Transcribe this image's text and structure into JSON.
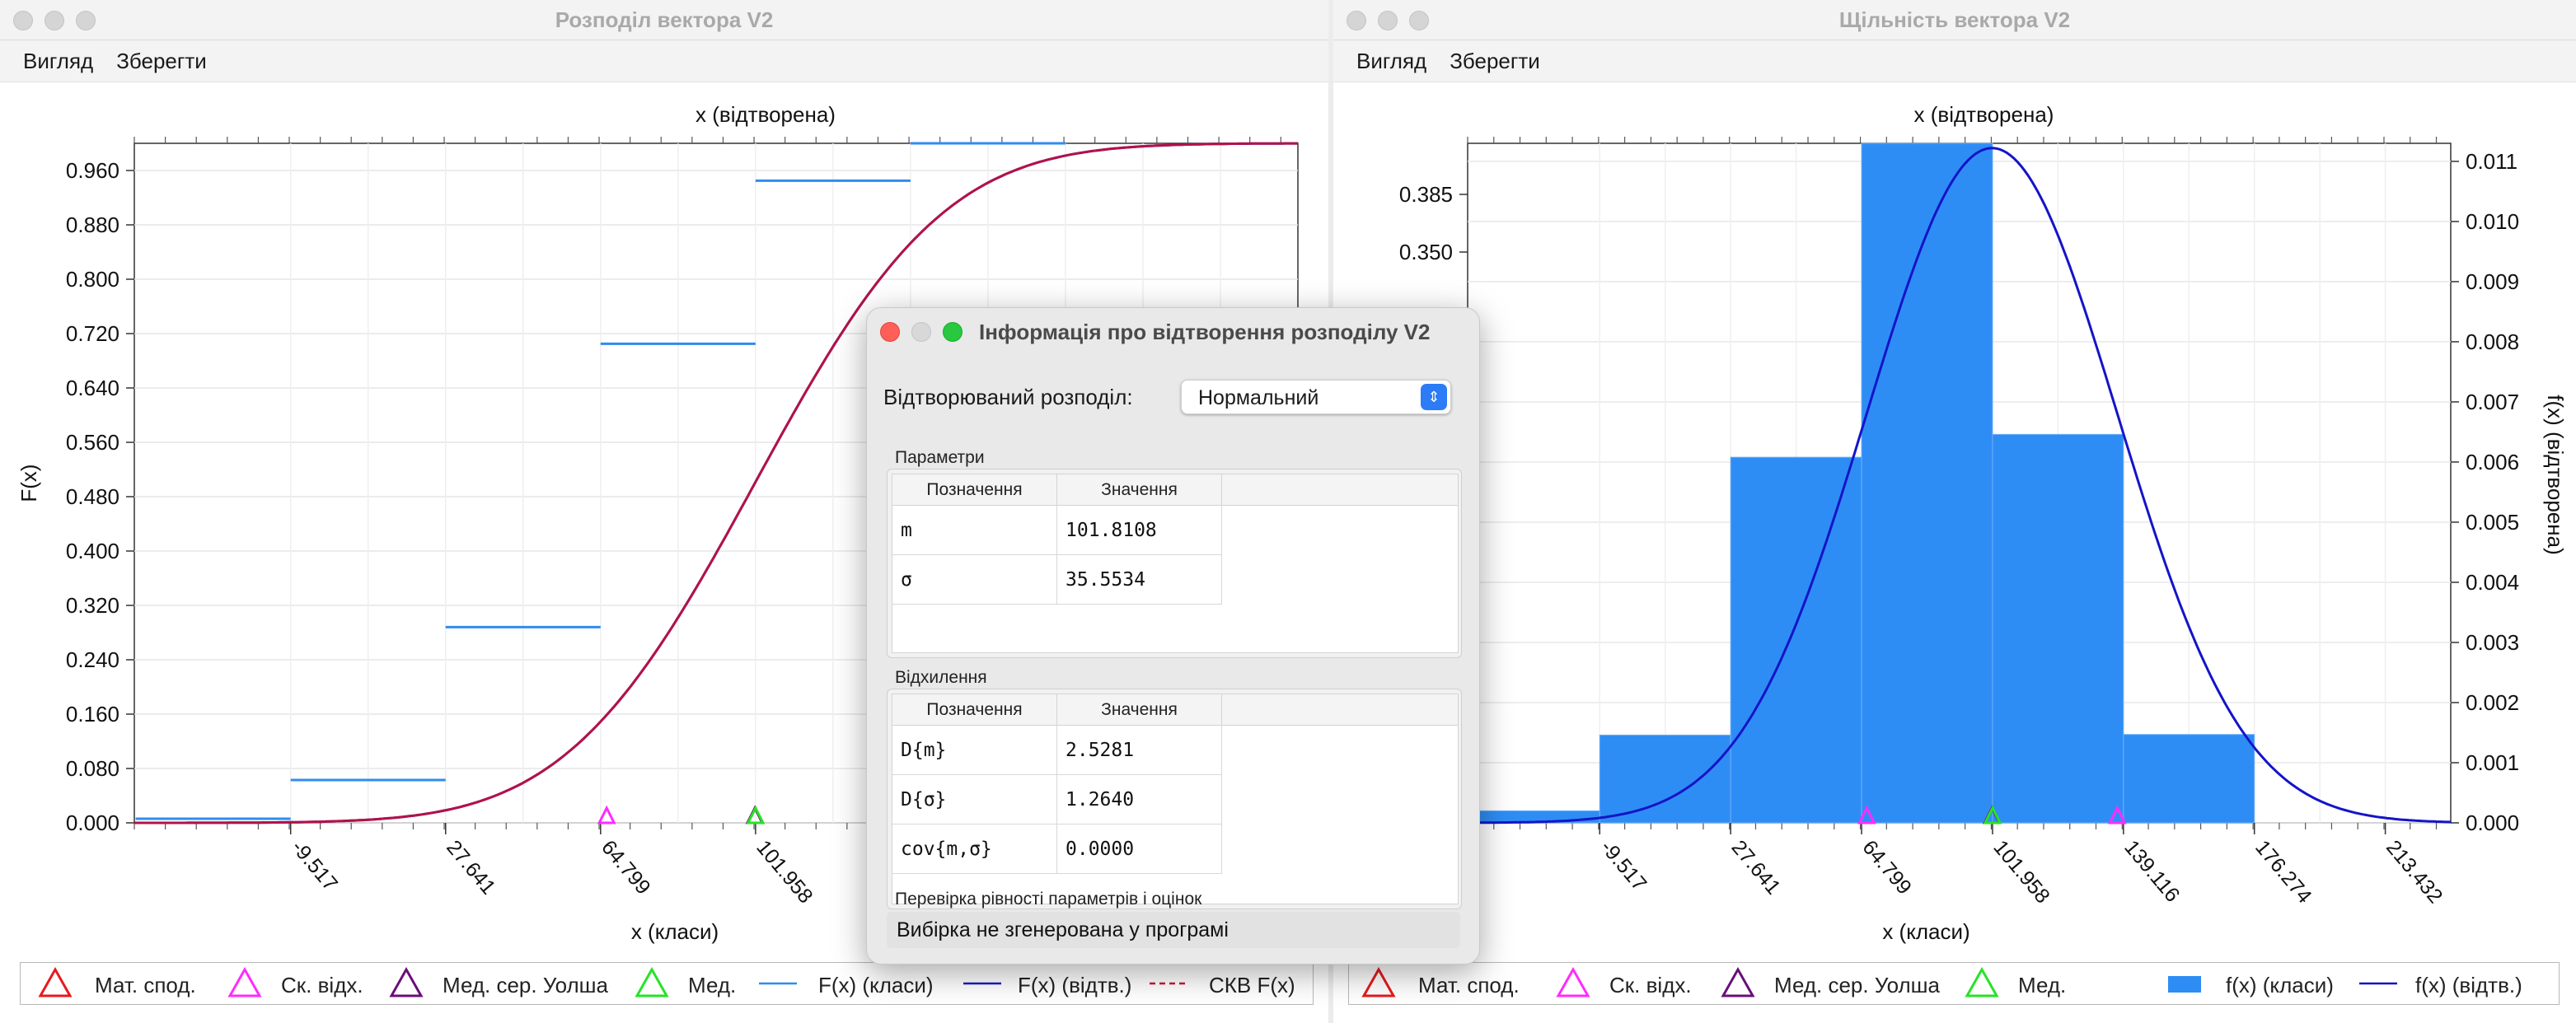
{
  "left_window": {
    "title": "Розподіл вектора V2",
    "menu": [
      "Вигляд",
      "Зберегти"
    ],
    "plot": {
      "top_axis_label": "x (відтворена)",
      "x_label": "x (класи)",
      "y_label": "F(x)"
    },
    "legend": [
      "Мат. спод.",
      "Ск. відх.",
      "Мед. сер. Уолша",
      "Мед.",
      "F(x) (класи)",
      "F(x) (відтв.)",
      "СКВ F(x)"
    ]
  },
  "right_window": {
    "title": "Щільність вектора V2",
    "menu": [
      "Вигляд",
      "Зберегти"
    ],
    "plot": {
      "top_axis_label": "x (відтворена)",
      "x_label": "x (класи)",
      "y_right_label": "f(x) (відтворена)"
    },
    "legend": [
      "Мат. спод.",
      "Ск. відх.",
      "Мед. сер. Уолша",
      "Мед.",
      "f(x) (класи)",
      "f(x) (відтв.)"
    ]
  },
  "dialog": {
    "title": "Інформація про відтворення розподілу V2",
    "distribution_label": "Відтворюваний розподіл:",
    "distribution_value": "Нормальний",
    "params_label": "Параметри",
    "deviation_label": "Відхилення",
    "col_symbol": "Позначення",
    "col_value": "Значення",
    "params": [
      {
        "symbol": "m",
        "value": "101.8108"
      },
      {
        "symbol": "σ",
        "value": "35.5534"
      }
    ],
    "deviations": [
      {
        "symbol": "D{m}",
        "value": "2.5281"
      },
      {
        "symbol": "D{σ}",
        "value": "1.2640"
      },
      {
        "symbol": "cov{m,σ}",
        "value": "0.0000"
      }
    ],
    "check_label": "Перевірка рівності параметрів і оцінок",
    "check_text": "Вибірка не згенерована у програмі"
  },
  "colors": {
    "mean": "#e8191d",
    "std": "#ff2bff",
    "walsh": "#6a0f7a",
    "median": "#25e325",
    "ecdf": "#2f8cf0",
    "cdf": "#1a1acc",
    "cdf_red": "#d01030",
    "hist": "#2e8df5",
    "pdf": "#1414c8"
  },
  "chart_data": [
    {
      "type": "line",
      "title": "",
      "xlabel": "x (класи)",
      "ylabel": "F(x)",
      "x2label": "x (відтворена)",
      "ylim": [
        0,
        1.0
      ],
      "xlim": [
        -47,
        232
      ],
      "x_ticks": [
        -9.517,
        27.641,
        64.799,
        101.958
      ],
      "y_ticks": [
        0.0,
        0.08,
        0.16,
        0.24,
        0.32,
        0.4,
        0.48,
        0.56,
        0.64,
        0.72,
        0.8,
        0.88,
        0.96
      ],
      "series": [
        {
          "name": "F(x) (класи)",
          "kind": "step",
          "segments": [
            [
              -46.68,
              -9.517,
              0.006
            ],
            [
              -9.517,
              27.641,
              0.063
            ],
            [
              27.641,
              64.799,
              0.288
            ],
            [
              64.799,
              101.958,
              0.705
            ],
            [
              101.958,
              139.116,
              0.945
            ],
            [
              139.116,
              176.274,
              1.0
            ]
          ]
        },
        {
          "name": "F(x) (відтв.)",
          "kind": "normal_cdf",
          "m": 101.8108,
          "sigma": 35.5534
        },
        {
          "name": "СКВ F(x)",
          "kind": "normal_cdf",
          "m": 101.8108,
          "sigma": 35.5534
        }
      ],
      "markers": [
        {
          "name": "Мат. спод.",
          "x": 101.81
        },
        {
          "name": "Ск. відх.",
          "x": 66.26
        },
        {
          "name": "Мед. сер. Уолша",
          "x": 101.81
        },
        {
          "name": "Мед.",
          "x": 101.96
        }
      ]
    },
    {
      "type": "bar",
      "title": "",
      "xlabel": "x (класи)",
      "x2label": "x (відтворена)",
      "y2label": "f(x) (відтворена)",
      "xlim": [
        -47,
        232
      ],
      "x_ticks": [
        -9.517,
        27.641,
        64.799,
        101.958,
        139.116,
        176.274,
        213.432
      ],
      "y_left_ticks": [
        0.385,
        0.35
      ],
      "y_right_ticks": [
        0.0,
        0.001,
        0.002,
        0.003,
        0.004,
        0.005,
        0.006,
        0.007,
        0.008,
        0.009,
        0.01,
        0.011
      ],
      "y_right_lim": [
        0,
        0.0113
      ],
      "bins": [
        {
          "from": -46.68,
          "to": -9.517,
          "value": 0.0002
        },
        {
          "from": -9.517,
          "to": 27.641,
          "value": 0.00146
        },
        {
          "from": 27.641,
          "to": 64.799,
          "value": 0.00608
        },
        {
          "from": 64.799,
          "to": 101.958,
          "value": 0.0113
        },
        {
          "from": 101.958,
          "to": 139.116,
          "value": 0.00646
        },
        {
          "from": 139.116,
          "to": 176.274,
          "value": 0.00147
        }
      ],
      "series": [
        {
          "name": "f(x) (відтв.)",
          "kind": "normal_pdf",
          "m": 101.8108,
          "sigma": 35.5534
        }
      ],
      "markers": [
        {
          "name": "Мат. спод.",
          "x": 101.81
        },
        {
          "name": "Ск. відх.",
          "x": 66.26
        },
        {
          "name": "Ск. відх.",
          "x": 137.36
        },
        {
          "name": "Мед. сер. Уолша",
          "x": 101.81
        },
        {
          "name": "Мед.",
          "x": 101.96
        }
      ]
    }
  ]
}
